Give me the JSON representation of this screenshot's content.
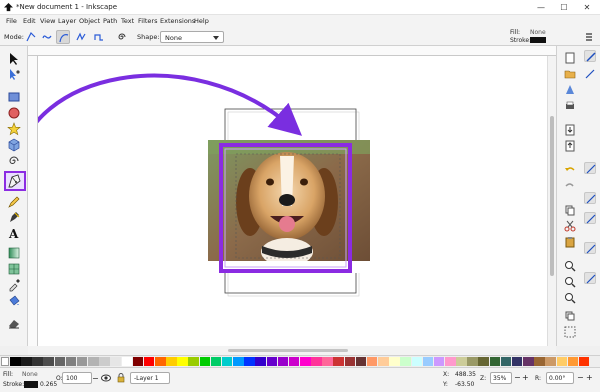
{
  "window": {
    "title": "*New document 1 - Inkscape",
    "minimize": "—",
    "maximize": "☐",
    "close": "✕"
  },
  "menu": [
    "File",
    "Edit",
    "View",
    "Layer",
    "Object",
    "Path",
    "Text",
    "Filters",
    "Extensions",
    "Help"
  ],
  "tool_controls": {
    "mode_label": "Mode:",
    "shape_label": "Shape:",
    "shape_value": "None"
  },
  "fill_stroke": {
    "fill_label": "Fill:",
    "fill_value": "None",
    "stroke_label": "Stroke:",
    "stroke_color": "#111111"
  },
  "status": {
    "fill_label": "Fill:",
    "fill_value": "None",
    "stroke_label": "Stroke:",
    "stroke_width": "0.265",
    "opacity_label": "O:",
    "opacity_value": "100",
    "layer_name": "-Layer 1",
    "x_label": "X:",
    "x_value": "488.35",
    "y_label": "Y:",
    "y_value": "-63.50",
    "zoom_label": "Z:",
    "zoom_value": "35%",
    "rotation_label": "R:",
    "rotation_value": "0.00°"
  },
  "colors": {
    "highlight": "#8b2be2",
    "arrow": "#7a2ee0"
  },
  "palette": [
    "#000000",
    "#1a1a1a",
    "#333333",
    "#4d4d4d",
    "#666666",
    "#808080",
    "#999999",
    "#b3b3b3",
    "#cccccc",
    "#e6e6e6",
    "#ffffff",
    "#800000",
    "#ff0000",
    "#ff6600",
    "#ffcc00",
    "#ffff00",
    "#99cc00",
    "#00cc00",
    "#00cc66",
    "#00cccc",
    "#0099ff",
    "#0033ff",
    "#3300cc",
    "#6600cc",
    "#9900cc",
    "#cc00cc",
    "#ff00cc",
    "#ff3399",
    "#ff6699",
    "#cc3333",
    "#993333",
    "#663333",
    "#ff9966",
    "#ffcc99",
    "#ffffcc",
    "#ccffcc",
    "#ccffff",
    "#99ccff",
    "#cc99ff",
    "#ff99cc",
    "#cccc99",
    "#999966",
    "#666633",
    "#336633",
    "#336666",
    "#333366",
    "#663366",
    "#996633",
    "#cc9966",
    "#ffcc66",
    "#ff9933",
    "#ff3300"
  ]
}
